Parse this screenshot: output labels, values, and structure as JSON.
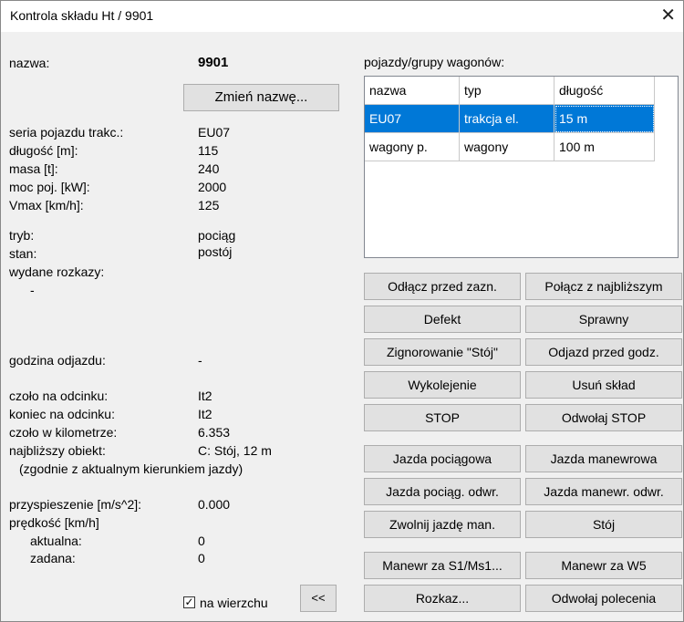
{
  "window": {
    "title": "Kontrola składu Ht / 9901",
    "close_glyph": "✕"
  },
  "left": {
    "name_label": "nazwa:",
    "name_value": "9901",
    "rename_button": "Zmień nazwę...",
    "props": [
      {
        "label": "seria pojazdu trakc.:",
        "value": "EU07"
      },
      {
        "label": "długość [m]:",
        "value": "115"
      },
      {
        "label": "masa [t]:",
        "value": "240"
      },
      {
        "label": "moc poj. [kW]:",
        "value": "2000"
      },
      {
        "label": "Vmax [km/h]:",
        "value": "125"
      }
    ],
    "mode_label": "tryb:",
    "mode_value": "pociąg",
    "state_label": "stan:",
    "state_value": "postój",
    "orders_label": "wydane rozkazy:",
    "orders_value": "-",
    "departure_label": "godzina odjazdu:",
    "departure_value": "-",
    "loc": [
      {
        "label": "czoło na odcinku:",
        "value": "It2"
      },
      {
        "label": "koniec na odcinku:",
        "value": "It2"
      },
      {
        "label": "czoło w kilometrze:",
        "value": "6.353"
      },
      {
        "label": "najbliższy obiekt:",
        "value": "C: Stój, 12 m"
      }
    ],
    "direction_note": "(zgodnie z aktualnym kierunkiem jazdy)",
    "accel_label": "przyspieszenie [m/s^2]:",
    "accel_value": "0.000",
    "speed_label": "prędkość [km/h]",
    "speed_actual_label": "aktualna:",
    "speed_actual_value": "0",
    "speed_set_label": "zadana:",
    "speed_set_value": "0",
    "on_top_label": "na wierzchu",
    "on_top_checked": true,
    "collapse_button": "<<"
  },
  "right": {
    "vehicles_label": "pojazdy/grupy wagonów:",
    "columns": [
      "nazwa",
      "typ",
      "długość"
    ],
    "rows": [
      {
        "name": "EU07",
        "type": "trakcja el.",
        "length": "15 m",
        "selected": true
      },
      {
        "name": "wagony p.",
        "type": "wagony",
        "length": "100 m",
        "selected": false
      }
    ],
    "buttons": {
      "detach": "Odłącz przed zazn.",
      "couple": "Połącz z najbliższym",
      "defect": "Defekt",
      "working": "Sprawny",
      "ignore_stop": "Zignorowanie \"Stój\"",
      "depart_early": "Odjazd przed godz.",
      "derail": "Wykolejenie",
      "remove": "Usuń skład",
      "stop": "STOP",
      "cancel_stop": "Odwołaj STOP",
      "train_run": "Jazda pociągowa",
      "shunt_run": "Jazda manewrowa",
      "train_run_rev": "Jazda pociąg. odwr.",
      "shunt_run_rev": "Jazda manewr. odwr.",
      "release_shunt": "Zwolnij jazdę man.",
      "halt": "Stój",
      "shunt_s1": "Manewr za S1/Ms1...",
      "shunt_w5": "Manewr za W5",
      "order": "Rozkaz...",
      "cancel_commands": "Odwołaj polecenia"
    }
  },
  "colors": {
    "selection": "#0078d7",
    "button_bg": "#e1e1e1"
  }
}
